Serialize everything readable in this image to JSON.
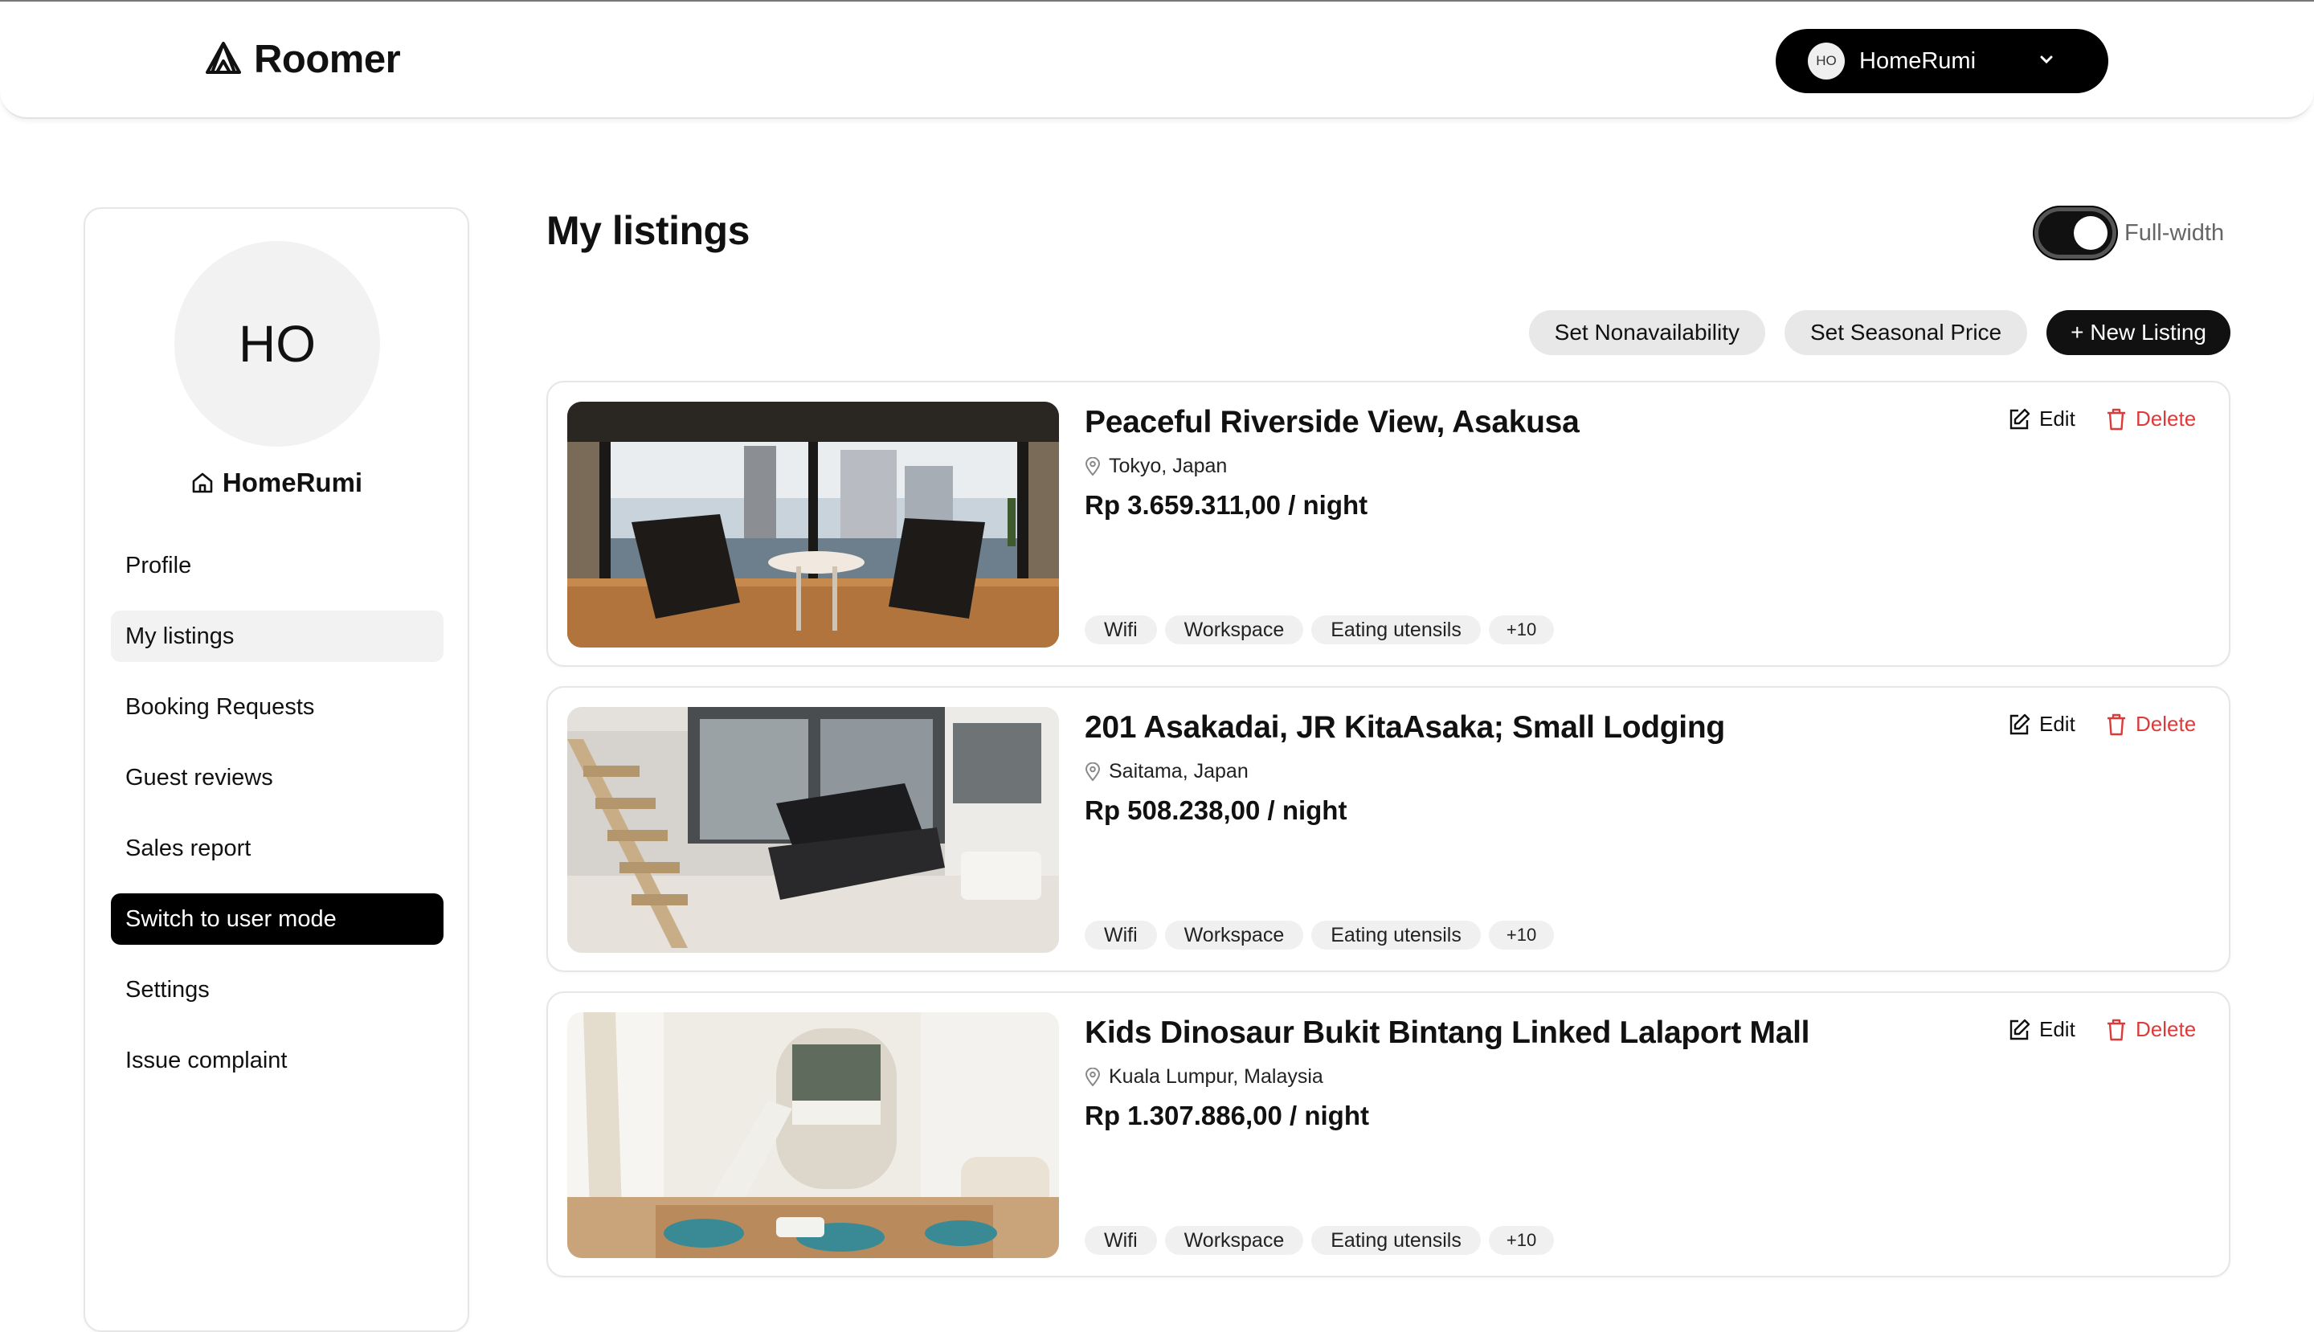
{
  "app": {
    "brand": "Roomer"
  },
  "header": {
    "user_initials": "HO",
    "user_name": "HomeRumi"
  },
  "sidebar": {
    "avatar_initials": "HO",
    "host_name": "HomeRumi",
    "items": [
      {
        "label": "Profile"
      },
      {
        "label": "My listings"
      },
      {
        "label": "Booking Requests"
      },
      {
        "label": "Guest reviews"
      },
      {
        "label": "Sales report"
      },
      {
        "label": "Switch to user mode"
      },
      {
        "label": "Settings"
      },
      {
        "label": "Issue complaint"
      }
    ]
  },
  "main": {
    "title": "My listings",
    "fullwidth_label": "Full-width",
    "fullwidth_on": true,
    "actions": {
      "nonavailability": "Set Nonavailability",
      "seasonal_price": "Set Seasonal Price",
      "new_listing": "+ New Listing"
    },
    "edit_label": "Edit",
    "delete_label": "Delete",
    "listings": [
      {
        "title": "Peaceful Riverside View, Asakusa",
        "location": "Tokyo, Japan",
        "price": "Rp 3.659.311,00 / night",
        "tags": [
          "Wifi",
          "Workspace",
          "Eating utensils",
          "+10"
        ]
      },
      {
        "title": "201 Asakadai, JR KitaAsaka; Small Lodging",
        "location": "Saitama, Japan",
        "price": "Rp 508.238,00 / night",
        "tags": [
          "Wifi",
          "Workspace",
          "Eating utensils",
          "+10"
        ]
      },
      {
        "title": "Kids Dinosaur Bukit Bintang Linked Lalaport Mall",
        "location": "Kuala Lumpur, Malaysia",
        "price": "Rp 1.307.886,00 / night",
        "tags": [
          "Wifi",
          "Workspace",
          "Eating utensils",
          "+10"
        ]
      }
    ]
  },
  "colors": {
    "accent": "#111111",
    "danger": "#dc3b3b",
    "muted_bg": "#f0f0f0"
  }
}
